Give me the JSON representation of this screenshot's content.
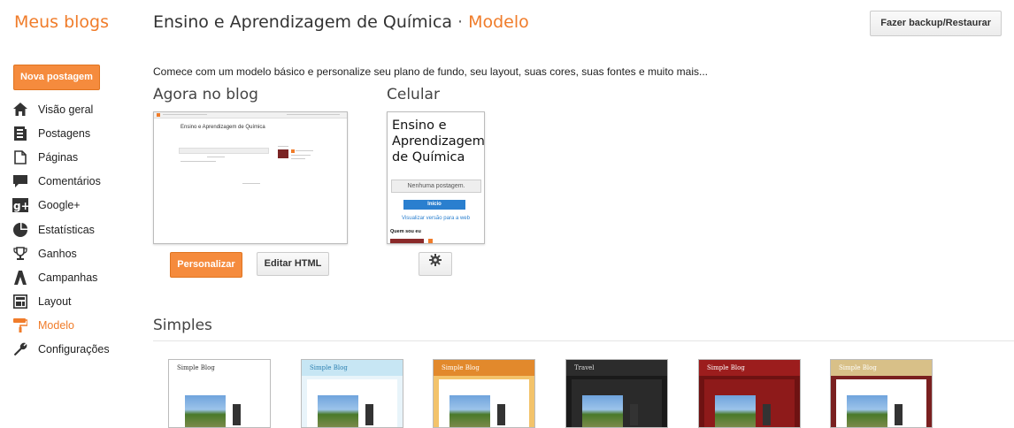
{
  "header": {
    "brand": "Meus blogs",
    "blog_title": "Ensino e Aprendizagem de Química",
    "separator": "·",
    "current_page": "Modelo",
    "backup_button": "Fazer backup/Restaurar"
  },
  "sidebar": {
    "new_post_button": "Nova postagem",
    "items": [
      {
        "label": "Visão geral",
        "icon": "home-icon"
      },
      {
        "label": "Postagens",
        "icon": "posts-icon"
      },
      {
        "label": "Páginas",
        "icon": "pages-icon"
      },
      {
        "label": "Comentários",
        "icon": "comments-icon"
      },
      {
        "label": "Google+",
        "icon": "google-plus-icon"
      },
      {
        "label": "Estatísticas",
        "icon": "stats-icon"
      },
      {
        "label": "Ganhos",
        "icon": "trophy-icon"
      },
      {
        "label": "Campanhas",
        "icon": "campaigns-icon"
      },
      {
        "label": "Layout",
        "icon": "layout-icon"
      },
      {
        "label": "Modelo",
        "icon": "paint-roller-icon",
        "active": true
      },
      {
        "label": "Configurações",
        "icon": "wrench-icon"
      }
    ]
  },
  "main": {
    "intro": "Comece com um modelo básico e personalize seu plano de fundo, seu layout, suas cores, suas fontes e muito mais...",
    "current": {
      "title": "Agora no blog",
      "preview_blog_title": "Ensino e Aprendizagem de Química",
      "customize_button": "Personalizar",
      "edit_html_button": "Editar HTML"
    },
    "mobile": {
      "title": "Celular",
      "blog_title": "Ensino e Aprendizagem de Química",
      "no_posts": "Nenhuma postagem.",
      "home_button": "Início",
      "web_link": "Visualizar versão para a web",
      "about_me": "Quem sou eu"
    },
    "simple": {
      "title": "Simples",
      "templates": [
        {
          "label": "Simple Blog",
          "header_color": "#ffffff",
          "bg": "#ffffff",
          "text_color": "#333333"
        },
        {
          "label": "Simple Blog",
          "header_color": "#c7e6f4",
          "bg": "#e8f4fa",
          "text_color": "#2a7fb0"
        },
        {
          "label": "Simple Blog",
          "header_color": "#e2892c",
          "bg": "#f3c36b",
          "text_color": "#ffffff"
        },
        {
          "label": "Travel",
          "header_color": "#2c2c2c",
          "bg": "#1a1a1a",
          "text_color": "#dddddd"
        },
        {
          "label": "Simple Blog",
          "header_color": "#9c1d1d",
          "bg": "#6e1212",
          "text_color": "#ffffff"
        },
        {
          "label": "Simple Blog",
          "header_color": "#d8c088",
          "bg": "#7a2020",
          "text_color": "#ffffff"
        }
      ]
    }
  }
}
